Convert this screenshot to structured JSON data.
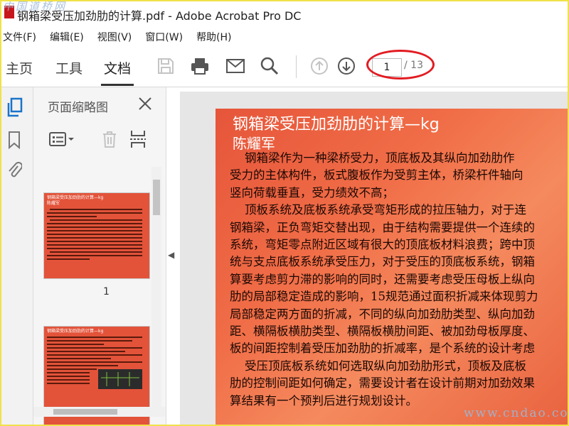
{
  "window": {
    "title": "钢箱梁受压加劲肋的计算.pdf - Adobe Acrobat Pro DC",
    "watermark_top": "中国道桥网",
    "watermark_bottom": "www.cndao.com"
  },
  "menu": [
    "文件(F)",
    "编辑(E)",
    "视图(V)",
    "窗口(W)",
    "帮助(H)"
  ],
  "tabs": [
    {
      "label": "主页",
      "active": false
    },
    {
      "label": "工具",
      "active": false
    },
    {
      "label": "文档",
      "active": true
    }
  ],
  "toolbar": {
    "icons": [
      "save-icon",
      "print-icon",
      "email-icon",
      "search-icon",
      "page-up-icon",
      "page-down-icon"
    ],
    "page_current": "1",
    "page_total": "/ 13"
  },
  "sidebar": {
    "icons": [
      "pages-icon",
      "bookmark-icon",
      "attachment-icon"
    ]
  },
  "thumb_panel": {
    "title": "页面缩略图",
    "page1_label": "1",
    "thumb1_title": "钢箱梁受压加劲肋的计算—kg",
    "thumb1_author": "陈耀军",
    "thumb2_title": "钢箱梁受压加劲肋的计算—kg"
  },
  "document": {
    "title": "钢箱梁受压加劲肋的计算—kg",
    "author": "陈耀军",
    "lines": [
      "    钢箱梁作为一种梁桥受力，顶底板及其纵向加劲肋作",
      "受力的主体构件，板式腹板作为受剪主体，桥梁杆件轴向",
      "竖向荷载垂直，受力绩效不高；",
      "    顶板系统及底板系统承受弯矩形成的拉压轴力，对于连",
      "钢箱梁，正负弯矩交替出现，由于结构需要提供一个连续的",
      "系统，弯矩零点附近区域有很大的顶底板材料浪费；跨中顶",
      "统与支点底板系统承受压力，对于受压的顶底板系统，钢箱",
      "算要考虑剪力滞的影响的同时，还需要考虑受压母板上纵向",
      "肋的局部稳定造成的影响，15规范通过面积折减来体现剪力",
      "局部稳定两方面的折减，不同的纵向加劲肋类型、纵向加劲",
      "距、横隔板横肋类型、横隔板横肋间距、被加劲母板厚度、",
      "板的间距控制着受压加劲肋的折减率，是个系统的设计考虑",
      "    受压顶底板系统如何选取纵向加劲肋形式，顶板及底板",
      "肋的控制间距如何确定，需要设计者在设计前期对加劲效果",
      "算结果有一个预判后进行规划设计。"
    ]
  }
}
